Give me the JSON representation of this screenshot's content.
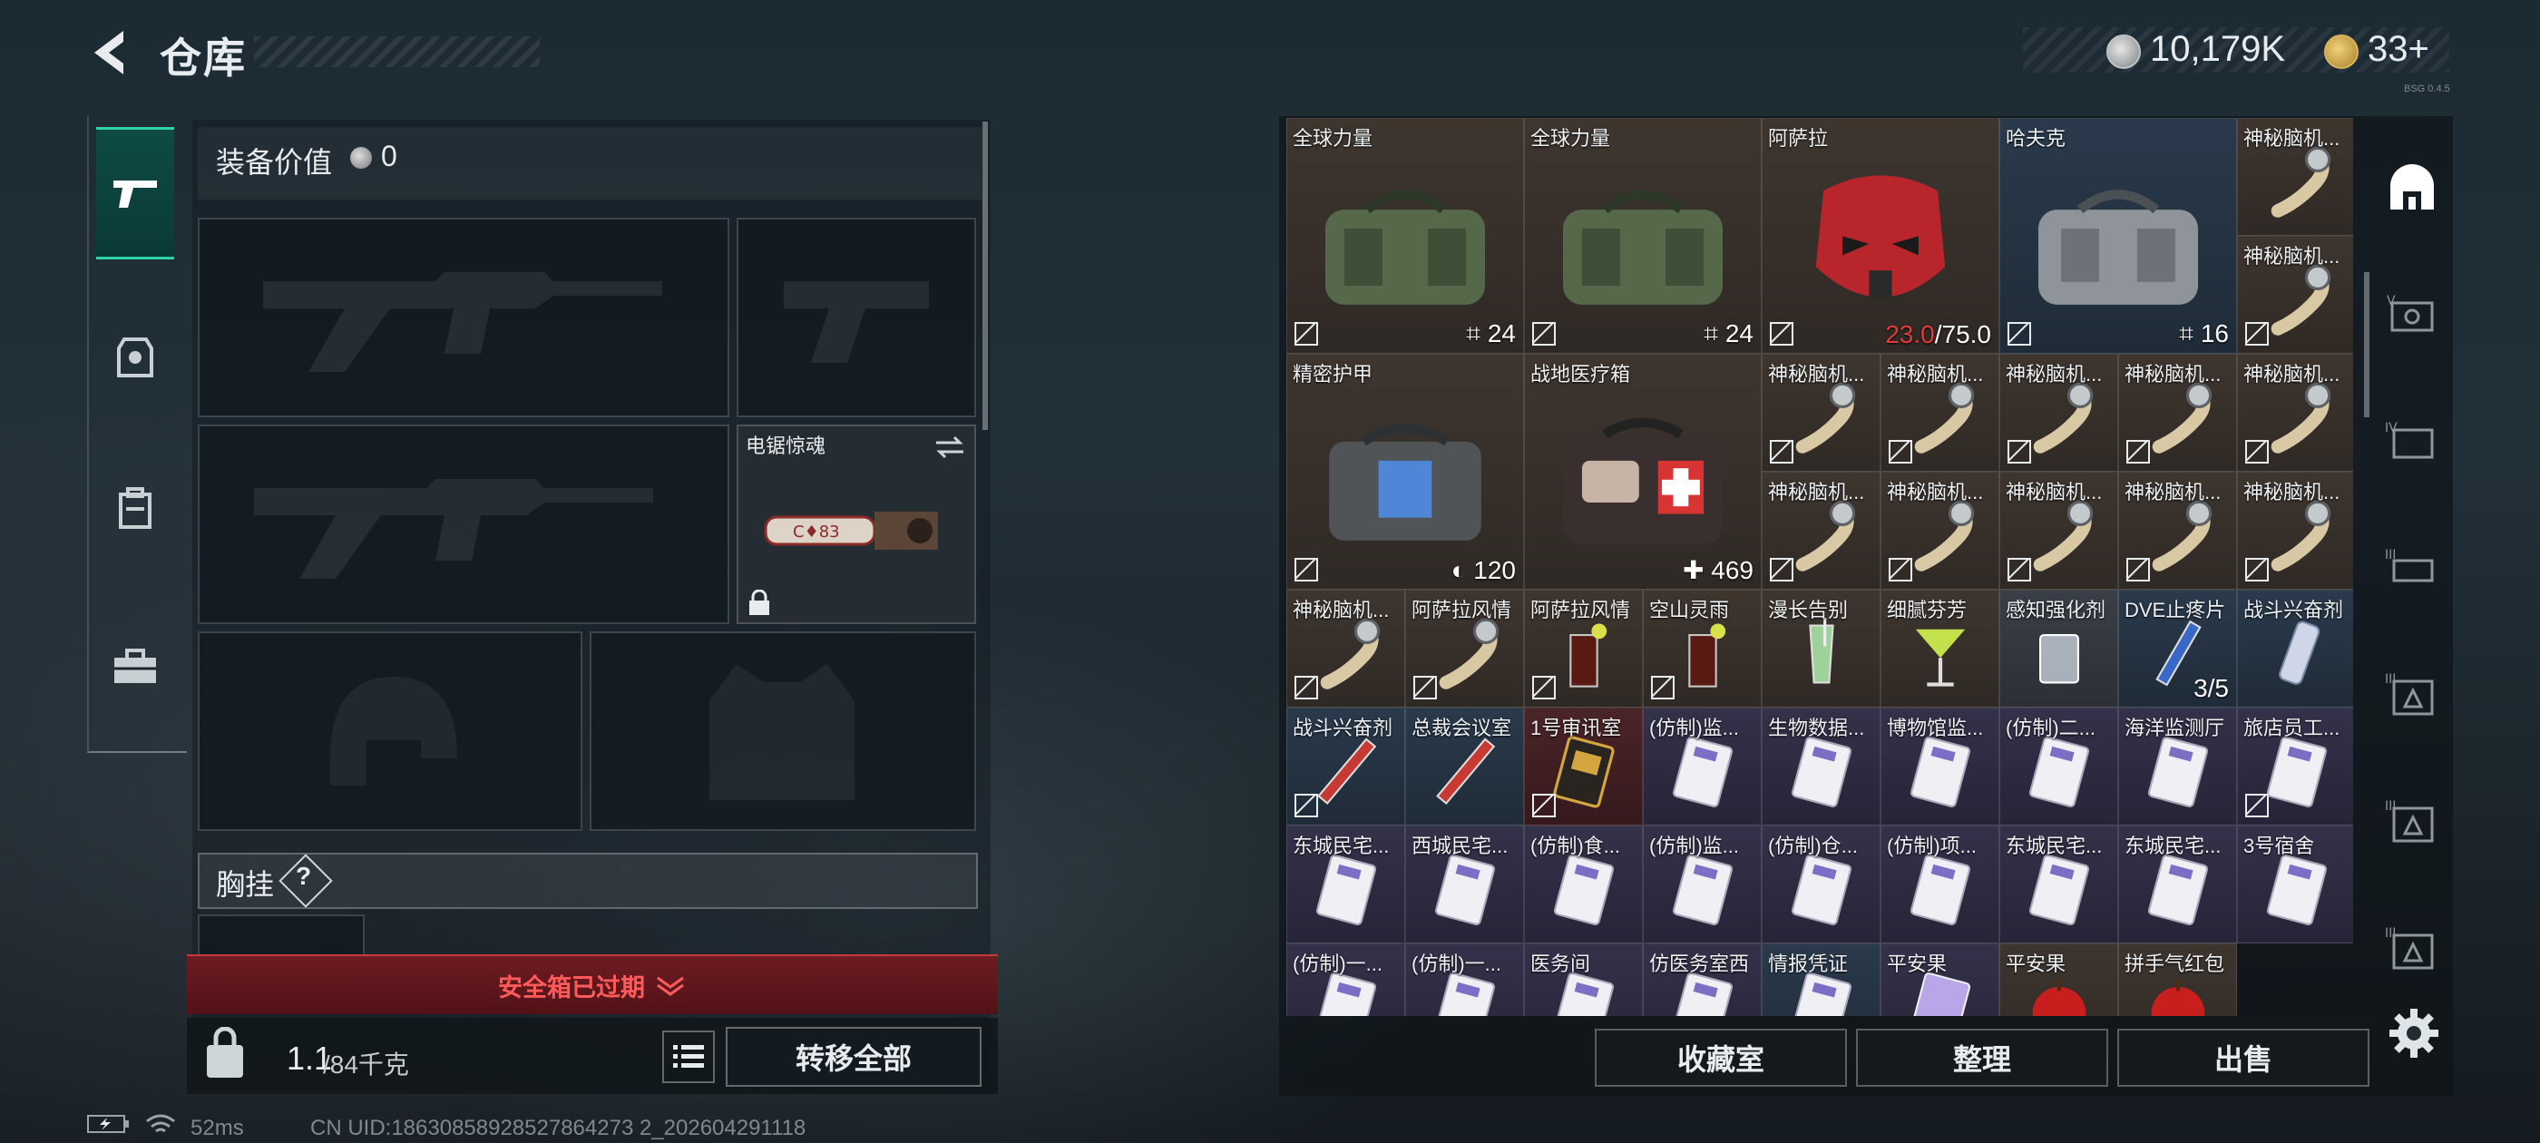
{
  "header": {
    "title": "仓库",
    "money": "10,179K",
    "tickets": "33+",
    "version": "BSG 0.4.5"
  },
  "categories": [
    "weapons-icon",
    "armor-icon",
    "backpack-icon",
    "toolbox-icon"
  ],
  "equipment": {
    "value_label": "装备价值",
    "value": "0",
    "melee_name": "电锯惊魂",
    "chest_label": "胸挂",
    "chest_help": "?",
    "safe_status": "安全箱已过期",
    "weight_current": "1.1",
    "weight_max": "/84千克",
    "transfer_all": "转移全部"
  },
  "status": {
    "ping": "52ms",
    "uid": "CN UID:18630858928527864273 2_202604291118"
  },
  "inventory": {
    "items": [
      {
        "name": "全球力量",
        "count": "24",
        "count_icon": "slots"
      },
      {
        "name": "全球力量",
        "count": "24",
        "count_icon": "slots"
      },
      {
        "name": "阿萨拉",
        "count_red": "23.0",
        "count": "/75.0"
      },
      {
        "name": "哈夫克",
        "count": "16",
        "count_icon": "slots"
      },
      {
        "name": "神秘脑机..."
      },
      {
        "name": "精密护甲",
        "count": "120",
        "count_icon": "shield"
      },
      {
        "name": "战地医疗箱",
        "count": "469",
        "count_icon": "plus"
      },
      {
        "name": "神秘脑机..."
      },
      {
        "name": "神秘脑机..."
      },
      {
        "name": "神秘脑机..."
      },
      {
        "name": "神秘脑机..."
      },
      {
        "name": "神秘脑机..."
      },
      {
        "name": "神秘脑机..."
      },
      {
        "name": "神秘脑机..."
      },
      {
        "name": "神秘脑机..."
      },
      {
        "name": "神秘脑机..."
      },
      {
        "name": "神秘脑机..."
      },
      {
        "name": "神秘脑机..."
      },
      {
        "name": "神秘脑机..."
      },
      {
        "name": "阿萨拉风情"
      },
      {
        "name": "阿萨拉风情"
      },
      {
        "name": "空山灵雨"
      },
      {
        "name": "漫长告别"
      },
      {
        "name": "细腻芬芳"
      },
      {
        "name": "感知强化剂"
      },
      {
        "name": "DVE止疼片",
        "count": "3/5"
      },
      {
        "name": "战斗兴奋剂"
      },
      {
        "name": "战斗兴奋剂"
      },
      {
        "name": "总裁会议室"
      },
      {
        "name": "1号审讯室"
      },
      {
        "name": "(仿制)监..."
      },
      {
        "name": "生物数据..."
      },
      {
        "name": "博物馆监..."
      },
      {
        "name": "(仿制)二..."
      },
      {
        "name": "海洋监测厅"
      },
      {
        "name": "旅店员工..."
      },
      {
        "name": "东城民宅..."
      },
      {
        "name": "西城民宅..."
      },
      {
        "name": "(仿制)食..."
      },
      {
        "name": "(仿制)监..."
      },
      {
        "name": "(仿制)仓..."
      },
      {
        "name": "(仿制)项..."
      },
      {
        "name": "东城民宅..."
      },
      {
        "name": "东城民宅..."
      },
      {
        "name": "3号宿舍"
      },
      {
        "name": "(仿制)一..."
      },
      {
        "name": "(仿制)一..."
      },
      {
        "name": "医务间"
      },
      {
        "name": "仿医务室西"
      },
      {
        "name": "情报凭证"
      },
      {
        "name": "平安果"
      },
      {
        "name": "平安果"
      },
      {
        "name": "拼手气红包"
      }
    ]
  },
  "side_tabs": [
    "head-icon",
    "tab-v-icon",
    "tab-iv-icon",
    "tab-iii-icon",
    "tab-iii-a-icon",
    "tab-iii-b-icon",
    "tab-iii-c-icon"
  ],
  "bottom_buttons": {
    "collection": "收藏室",
    "sort": "整理",
    "sell": "出售"
  }
}
